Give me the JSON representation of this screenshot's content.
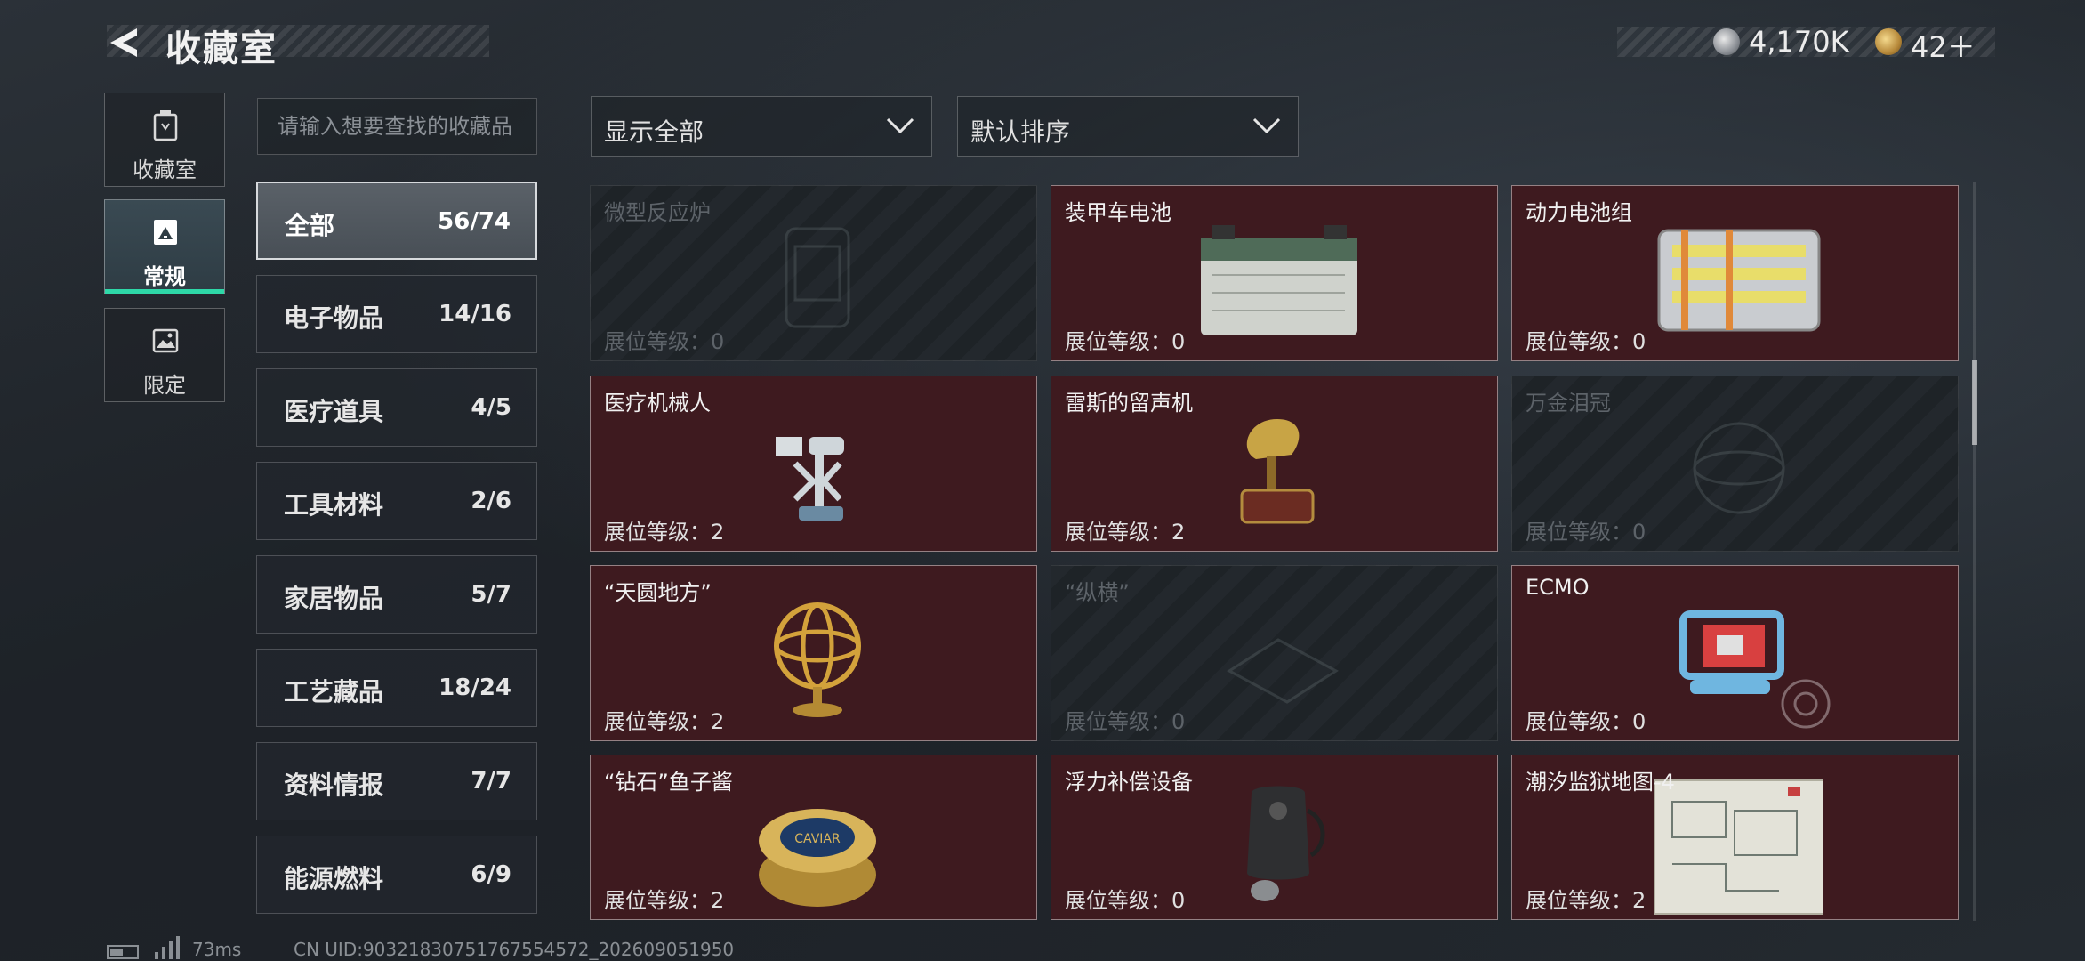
{
  "header": {
    "title": "收藏室",
    "currency1": "4,170K",
    "currency2": "42＋"
  },
  "left_tabs": [
    {
      "label": "收藏室",
      "icon": "trash-can-icon"
    },
    {
      "label": "常规",
      "icon": "photo-frame-icon",
      "active": true
    },
    {
      "label": "限定",
      "icon": "picture-icon"
    }
  ],
  "search": {
    "placeholder": "请输入想要查找的收藏品"
  },
  "categories": [
    {
      "name": "全部",
      "count": "56/74",
      "active": true
    },
    {
      "name": "电子物品",
      "count": "14/16"
    },
    {
      "name": "医疗道具",
      "count": "4/5"
    },
    {
      "name": "工具材料",
      "count": "2/6"
    },
    {
      "name": "家居物品",
      "count": "5/7"
    },
    {
      "name": "工艺藏品",
      "count": "18/24"
    },
    {
      "name": "资料情报",
      "count": "7/7"
    },
    {
      "name": "能源燃料",
      "count": "6/9"
    }
  ],
  "filters": {
    "display": "显示全部",
    "sort": "默认排序"
  },
  "items": [
    {
      "name": "微型反应炉",
      "level": "展位等级：0",
      "owned": false,
      "icon": "reactor-icon"
    },
    {
      "name": "装甲车电池",
      "level": "展位等级：0",
      "owned": true,
      "icon": "car-battery-icon"
    },
    {
      "name": "动力电池组",
      "level": "展位等级：0",
      "owned": true,
      "icon": "battery-pack-icon"
    },
    {
      "name": "医疗机械人",
      "level": "展位等级：2",
      "owned": true,
      "icon": "medical-robot-icon"
    },
    {
      "name": "雷斯的留声机",
      "level": "展位等级：2",
      "owned": true,
      "icon": "gramophone-icon"
    },
    {
      "name": "万金泪冠",
      "level": "展位等级：0",
      "owned": false,
      "icon": "crown-icon"
    },
    {
      "name": "“天圆地方”",
      "level": "展位等级：2",
      "owned": true,
      "icon": "armillary-sphere-icon"
    },
    {
      "name": "“纵横”",
      "level": "展位等级：0",
      "owned": false,
      "icon": "chessboard-icon"
    },
    {
      "name": "ECMO",
      "level": "展位等级：0",
      "owned": true,
      "icon": "ecmo-machine-icon"
    },
    {
      "name": "“钻石”鱼子酱",
      "level": "展位等级：2",
      "owned": true,
      "icon": "caviar-tin-icon",
      "art_text": "CAVIAR"
    },
    {
      "name": "浮力补偿设备",
      "level": "展位等级：0",
      "owned": true,
      "icon": "bcd-vest-icon"
    },
    {
      "name": "潮汐监狱地图-4",
      "level": "展位等级：2",
      "owned": true,
      "icon": "map-sheet-icon"
    }
  ],
  "footer": {
    "ping": "73ms",
    "uid": "CN UID:9032183075176755457​2_202609051950"
  },
  "colors": {
    "owned_card": "#3e1a1f",
    "active_tab_accent": "#2ed8a8"
  }
}
